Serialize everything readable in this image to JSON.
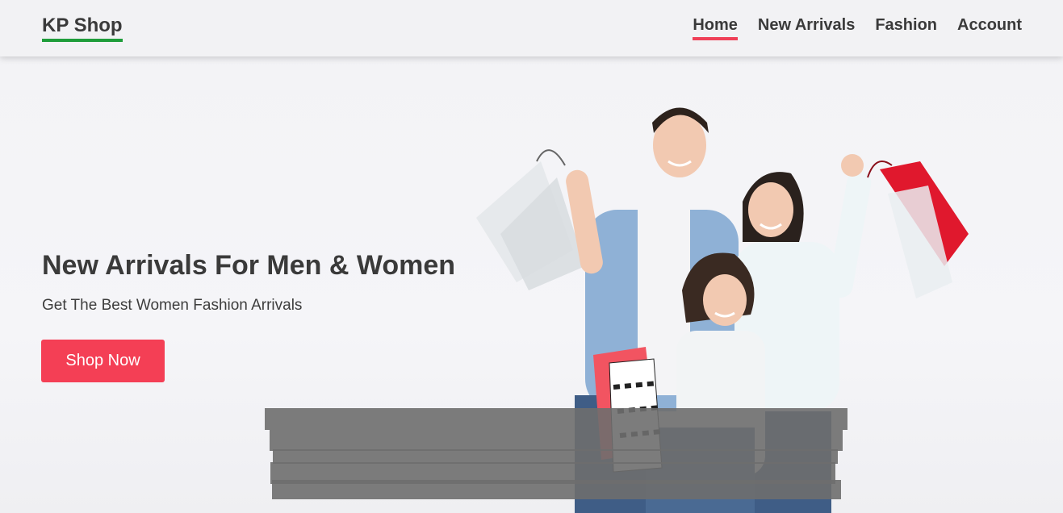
{
  "header": {
    "brand": "KP Shop",
    "nav": [
      {
        "label": "Home",
        "active": true
      },
      {
        "label": "New Arrivals",
        "active": false
      },
      {
        "label": "Fashion",
        "active": false
      },
      {
        "label": "Account",
        "active": false
      }
    ]
  },
  "hero": {
    "title": "New Arrivals For Men & Women",
    "subtitle": "Get The Best Women Fashion Arrivals",
    "cta_label": "Shop Now"
  },
  "colors": {
    "brand_underline": "#1f9d3a",
    "accent": "#f43f55",
    "text": "#3a3a3a"
  }
}
